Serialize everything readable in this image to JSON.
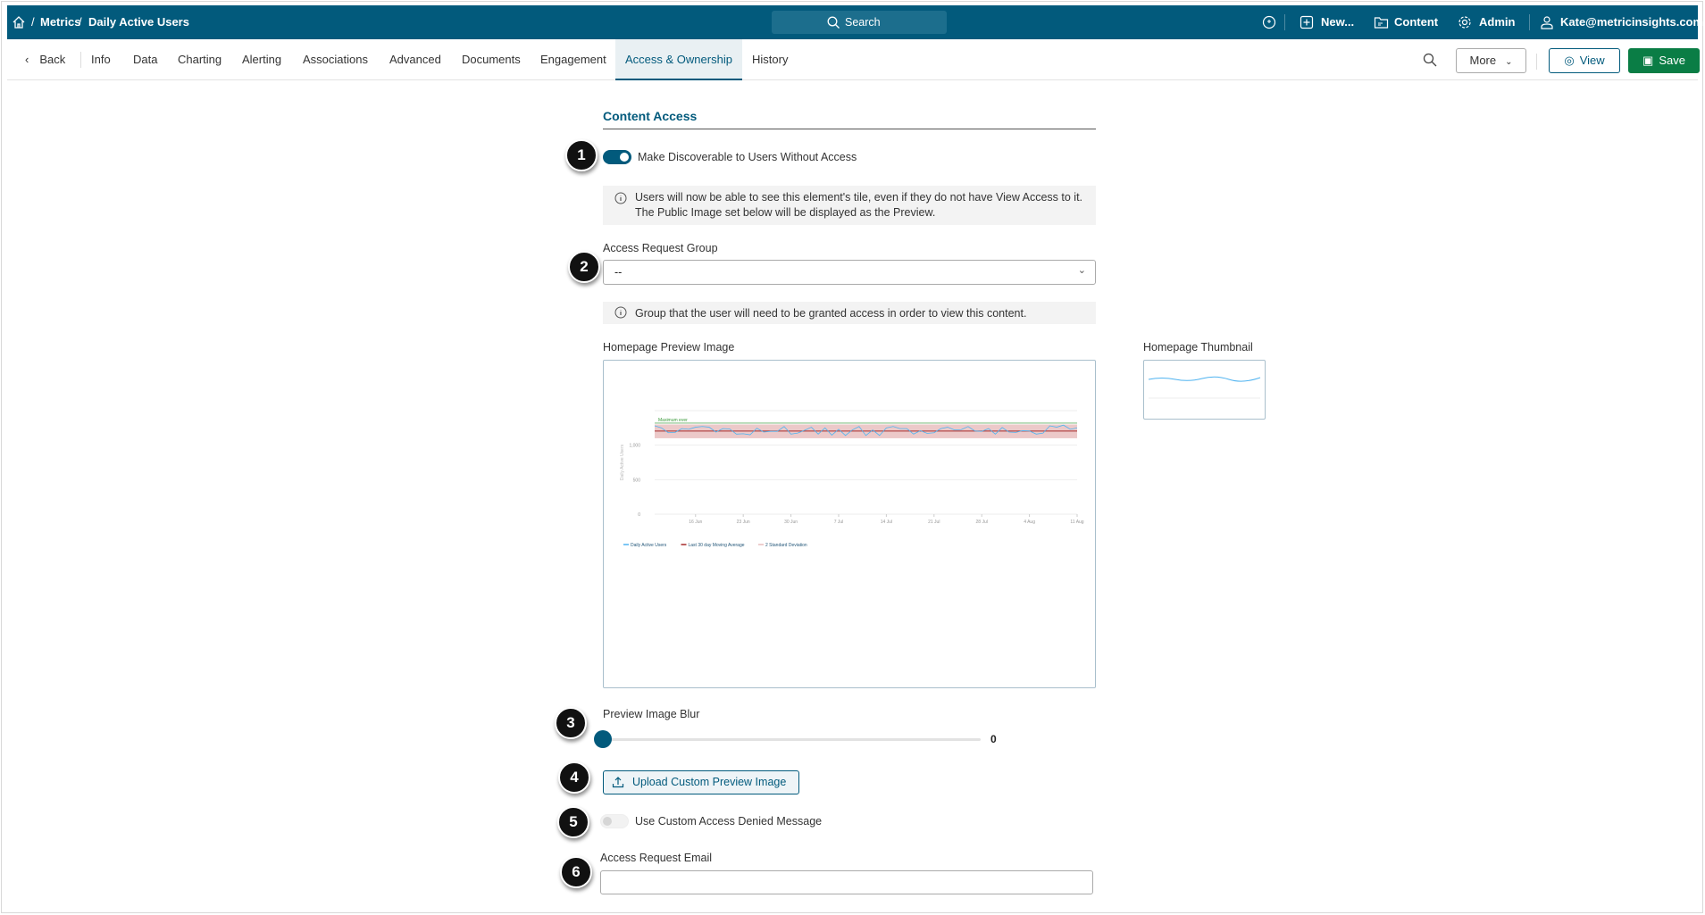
{
  "topbar": {
    "breadcrumb": [
      "Metrics",
      "Daily Active Users"
    ],
    "search_label": "Search",
    "new_label": "New...",
    "content_label": "Content",
    "admin_label": "Admin",
    "user_email": "Kate@metricinsights.com"
  },
  "tabs": {
    "back_label": "Back",
    "items": [
      "Info",
      "Data",
      "Charting",
      "Alerting",
      "Associations",
      "Advanced",
      "Documents",
      "Engagement",
      "Access & Ownership",
      "History"
    ],
    "active": "Access & Ownership",
    "more_label": "More",
    "view_label": "View",
    "save_label": "Save"
  },
  "content": {
    "section_title": "Content Access",
    "discoverable_label": "Make Discoverable to Users Without Access",
    "discoverable_on": true,
    "discoverable_info": "Users will now be able to see this element's tile, even if they do not have View Access to it. The Public Image set below will be displayed as the Preview.",
    "access_group_label": "Access Request Group",
    "access_group_value": "--",
    "access_group_info": "Group that the user will need to be granted access in order to view this content.",
    "preview_image_label": "Homepage Preview Image",
    "thumbnail_label": "Homepage Thumbnail",
    "blur_label": "Preview Image Blur",
    "blur_value": "0",
    "upload_label": "Upload Custom Preview Image",
    "custom_denied_label": "Use Custom Access Denied Message",
    "custom_denied_on": false,
    "email_label": "Access Request Email",
    "email_value": ""
  },
  "badges": [
    "1",
    "2",
    "3",
    "4",
    "5",
    "6"
  ],
  "colors": {
    "brand": "#025a7c",
    "save": "#0a7d45",
    "dau": "#4fb3f0",
    "avg": "#a52a2a",
    "band": "#e7bcbc",
    "max": "#3a9a3a"
  },
  "chart_data": {
    "type": "line",
    "ylabel": "Daily Active Users",
    "ylim": [
      0,
      1500
    ],
    "yticks": [
      "0",
      "500",
      "1,000"
    ],
    "ytick_values": [
      0,
      500,
      1000
    ],
    "xticks": [
      "16 Jun",
      "23 Jun",
      "30 Jun",
      "7 Jul",
      "14 Jul",
      "21 Jul",
      "28 Jul",
      "4 Aug",
      "11 Aug"
    ],
    "xtick_index": [
      6,
      13,
      20,
      27,
      34,
      41,
      48,
      55,
      62
    ],
    "max_label": "Maximum ever",
    "max_value": 1320,
    "legend": [
      "Daily Active Users",
      "Last 30 day Moving Average",
      "2 Standard Deviation"
    ],
    "series": [
      {
        "name": "Daily Active Users",
        "values": [
          1280,
          1250,
          1180,
          1185,
          1240,
          1230,
          1260,
          1270,
          1260,
          1190,
          1240,
          1235,
          1160,
          1165,
          1150,
          1245,
          1190,
          1200,
          1200,
          1270,
          1160,
          1175,
          1215,
          1260,
          1160,
          1250,
          1145,
          1230,
          1140,
          1220,
          1270,
          1140,
          1220,
          1140,
          1250,
          1270,
          1240,
          1240,
          1160,
          1210,
          1170,
          1180,
          1240,
          1260,
          1220,
          1225,
          1270,
          1205,
          1200,
          1240,
          1160,
          1255,
          1190,
          1185,
          1210,
          1205,
          1160,
          1175,
          1280,
          1260,
          1290,
          1230,
          1250
        ]
      },
      {
        "name": "Last 30 day Moving Average",
        "value": 1205
      },
      {
        "name": "2 Standard Deviation",
        "low": 1100,
        "high": 1300
      }
    ]
  }
}
